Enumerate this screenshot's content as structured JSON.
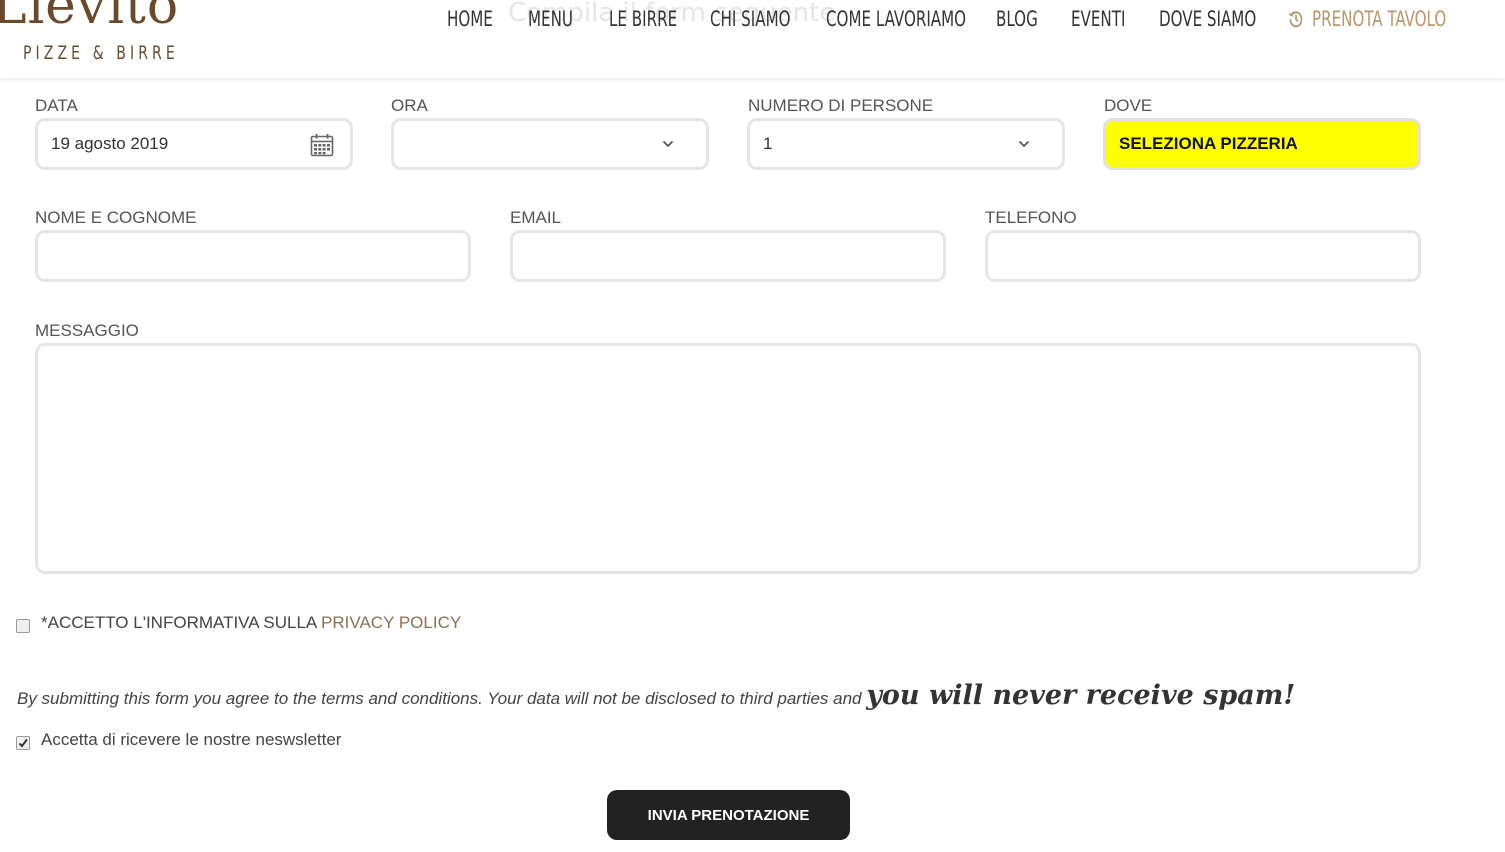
{
  "header": {
    "logo_word": "Lievito",
    "logo_sub": "PIZZE & BIRRE",
    "ghost_text": "Compila il form seguente",
    "nav": [
      "HOME",
      "MENU",
      "LE BIRRE",
      "CHI SIAMO",
      "COME LAVORIAMO",
      "BLOG",
      "EVENTI",
      "DOVE SIAMO"
    ],
    "book_label": "PRENOTA TAVOLO",
    "book_icon": "history-icon"
  },
  "form": {
    "data_label": "DATA",
    "data_value": "19 agosto 2019",
    "ora_label": "ORA",
    "ora_value": "",
    "persone_label": "NUMERO DI PERSONE",
    "persone_value": "1",
    "dove_label": "DOVE",
    "dove_value": "SELEZIONA PIZZERIA",
    "nome_label": "NOME E COGNOME",
    "email_label": "EMAIL",
    "telefono_label": "TELEFONO",
    "messaggio_label": "MESSAGGIO",
    "privacy_prefix": "*ACCETTO L'INFORMATIVA SULLA",
    "privacy_link": "PRIVACY POLICY",
    "privacy_checked": false,
    "terms_text": "By submitting this form you agree to the terms and conditions. Your data will not be disclosed to third parties and",
    "spam_text": "you will never receive spam!",
    "newsletter_label": "Accetta di ricevere le nostre neswsletter",
    "newsletter_checked": true,
    "submit_label": "INVIA PRENOTAZIONE"
  },
  "colors": {
    "accent": "#b99768",
    "brand": "#6a4a2a",
    "highlight": "#ffff00",
    "button": "#222222"
  }
}
